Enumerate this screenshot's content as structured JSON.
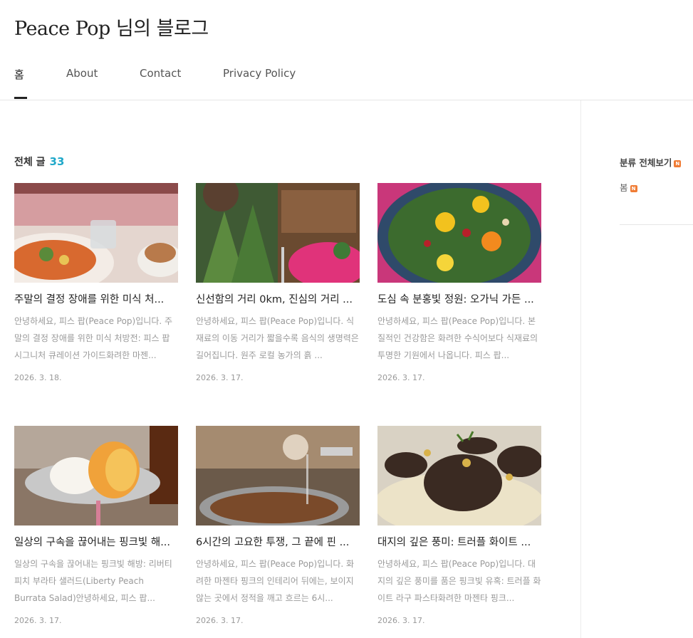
{
  "site": {
    "title": "Peace Pop 님의 블로그"
  },
  "nav": [
    {
      "label": "홈"
    },
    {
      "label": "About"
    },
    {
      "label": "Contact"
    },
    {
      "label": "Privacy Policy"
    }
  ],
  "list": {
    "heading": "전체 글",
    "count": "33"
  },
  "posts": [
    {
      "title": "주말의 결정 장애를 위한 미식 처...",
      "summary": "안녕하세요, 피스 팝(Peace Pop)입니다. 주말의 결정 장애를 위한 미식 처방전: 피스 팝 시그니처 큐레이션 가이드화려한 마젠...",
      "date": "2026. 3. 18."
    },
    {
      "title": "신선함의 거리 0km, 진심의 거리 ...",
      "summary": "안녕하세요, 피스 팝(Peace Pop)입니다. 식재료의 이동 거리가 짧을수록 음식의 생명력은 길어집니다. 원주 로컬 농가의 흙 ...",
      "date": "2026. 3. 17."
    },
    {
      "title": "도심 속 분홍빛 정원: 오가닉 가든 ...",
      "summary": "안녕하세요, 피스 팝(Peace Pop)입니다. 본질적인 건강함은 화려한 수식어보다 식재료의 투명한 기원에서 나옵니다. 피스 팝...",
      "date": "2026. 3. 17."
    },
    {
      "title": "일상의 구속을 끊어내는 핑크빛 해...",
      "summary": "일상의 구속을 끊어내는 핑크빛 해방: 리버티 피치 부라타 샐러드(Liberty Peach Burrata Salad)안녕하세요, 피스 팝...",
      "date": "2026. 3. 17."
    },
    {
      "title": "6시간의 고요한 투쟁, 그 끝에 핀 ...",
      "summary": "안녕하세요, 피스 팝(Peace Pop)입니다. 화려한 마젠타 핑크의 인테리어 뒤에는, 보이지 않는 곳에서 정적을 깨고 흐르는 6시...",
      "date": "2026. 3. 17."
    },
    {
      "title": "대지의 깊은 풍미: 트러플 화이트 ...",
      "summary": "안녕하세요, 피스 팝(Peace Pop)입니다. 대지의 깊은 풍미를 품은 핑크빛 유혹: 트러플 화이트 라구 파스타화려한 마젠타 핑크...",
      "date": "2026. 3. 17."
    }
  ],
  "sidebar": {
    "category_title": "분류 전체보기",
    "categories": [
      {
        "label": "봄"
      }
    ],
    "new_badge": "N"
  }
}
